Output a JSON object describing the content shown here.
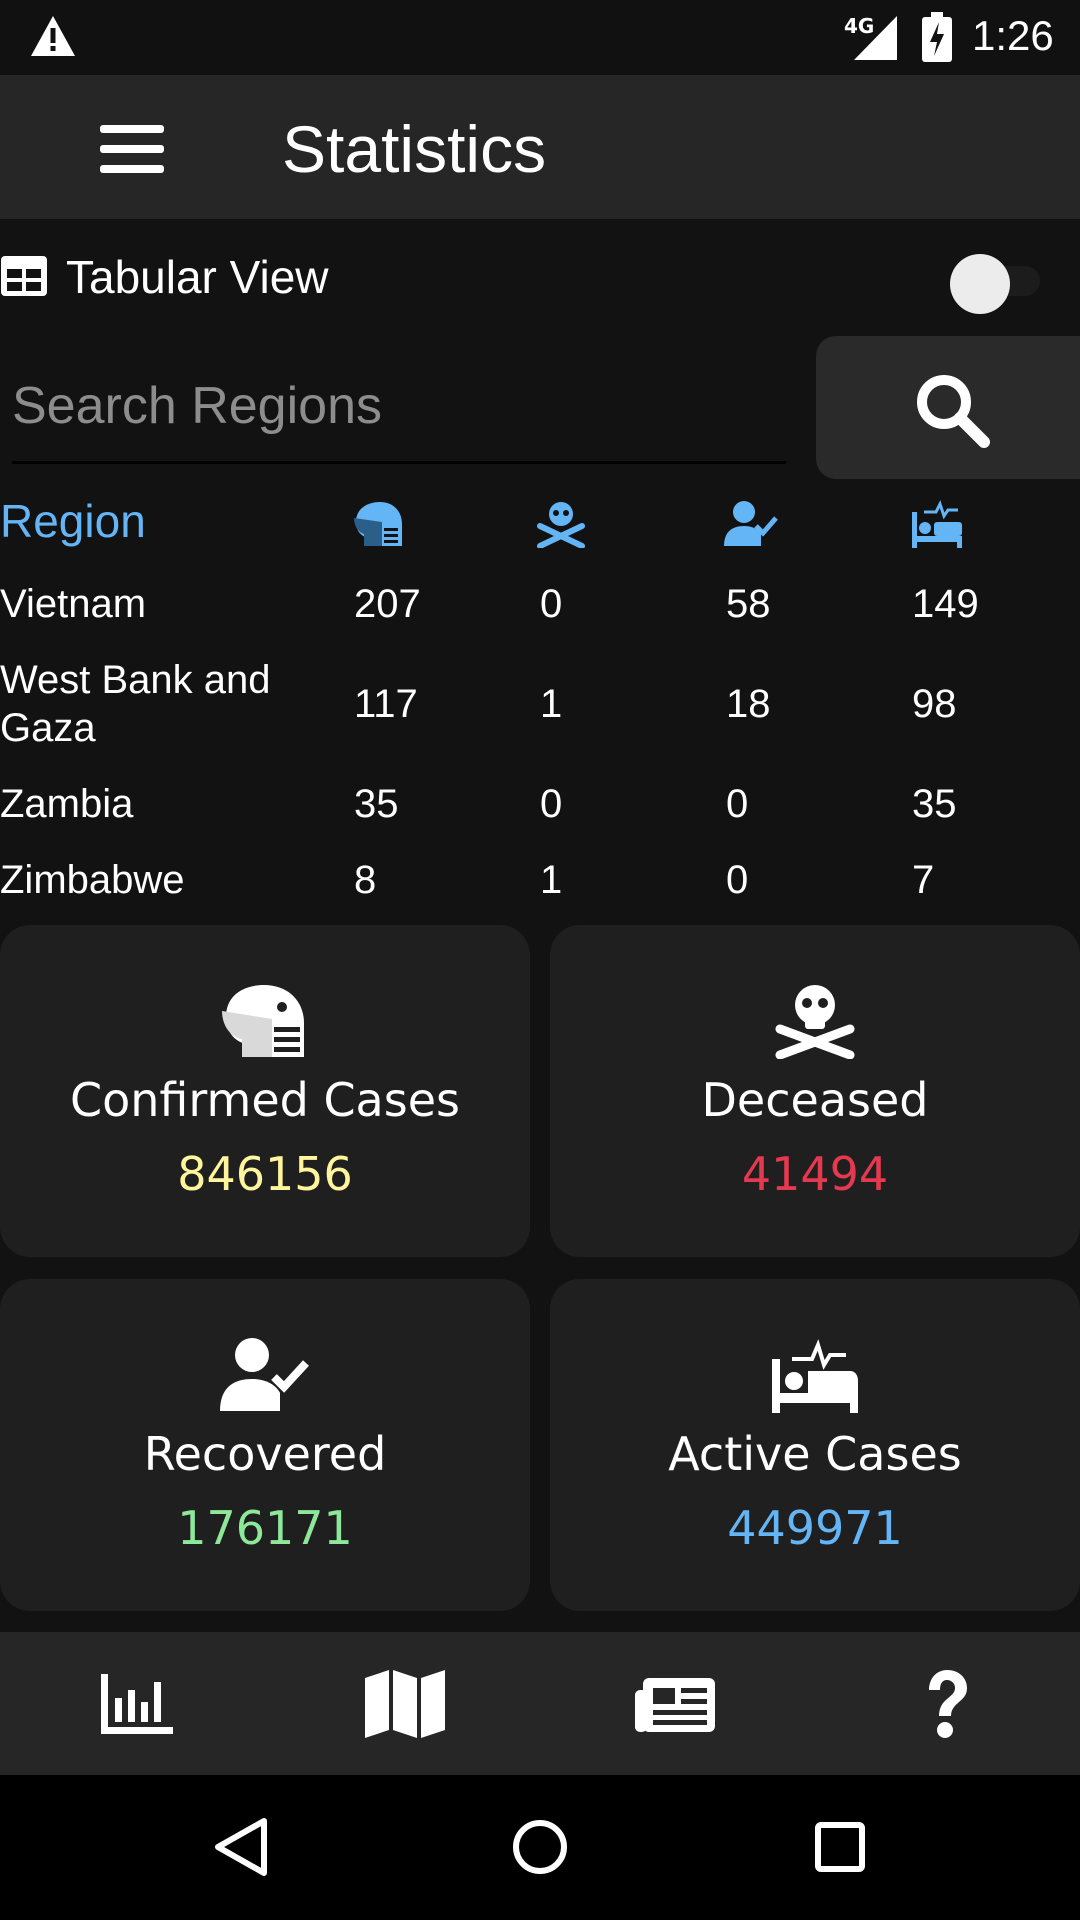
{
  "status_bar": {
    "network": "4G",
    "time": "1:26",
    "icons": [
      "warning-icon",
      "signal-icon",
      "battery-charging-icon"
    ]
  },
  "app_bar": {
    "title": "Statistics",
    "menu_icon": "hamburger-menu-icon"
  },
  "view_toggle": {
    "label": "Tabular View",
    "icon": "table-grid-icon",
    "enabled": false
  },
  "search": {
    "placeholder": "Search Regions",
    "value": "",
    "icon": "search-icon"
  },
  "table": {
    "header": {
      "region": "Region",
      "columns": [
        "confirmed-icon",
        "deceased-icon",
        "recovered-icon",
        "active-icon"
      ]
    },
    "rows": [
      {
        "region": "Vietnam",
        "confirmed": "207",
        "deceased": "0",
        "recovered": "58",
        "active": "149"
      },
      {
        "region": "West Bank and Gaza",
        "confirmed": "117",
        "deceased": "1",
        "recovered": "18",
        "active": "98"
      },
      {
        "region": "Zambia",
        "confirmed": "35",
        "deceased": "0",
        "recovered": "0",
        "active": "35"
      },
      {
        "region": "Zimbabwe",
        "confirmed": "8",
        "deceased": "1",
        "recovered": "0",
        "active": "7"
      }
    ]
  },
  "cards": {
    "confirmed": {
      "title": "Confirmed Cases",
      "value": "846156",
      "color": "#fff59d",
      "icon": "masked-head-icon"
    },
    "deceased": {
      "title": "Deceased",
      "value": "41494",
      "color": "#e53950",
      "icon": "skull-crossbones-icon"
    },
    "recovered": {
      "title": "Recovered",
      "value": "176171",
      "color": "#8ee89a",
      "icon": "user-check-icon"
    },
    "active": {
      "title": "Active Cases",
      "value": "449971",
      "color": "#64b5f6",
      "icon": "hospital-bed-icon"
    }
  },
  "colors": {
    "accent": "#64b5f6",
    "background": "#121212",
    "bar": "#262626",
    "card": "#1f1f1f"
  },
  "bottom_nav": {
    "items": [
      "chart-bar-icon",
      "map-icon",
      "newspaper-icon",
      "question-icon"
    ]
  },
  "system_nav": {
    "items": [
      "back-icon",
      "home-icon",
      "recents-icon"
    ]
  }
}
